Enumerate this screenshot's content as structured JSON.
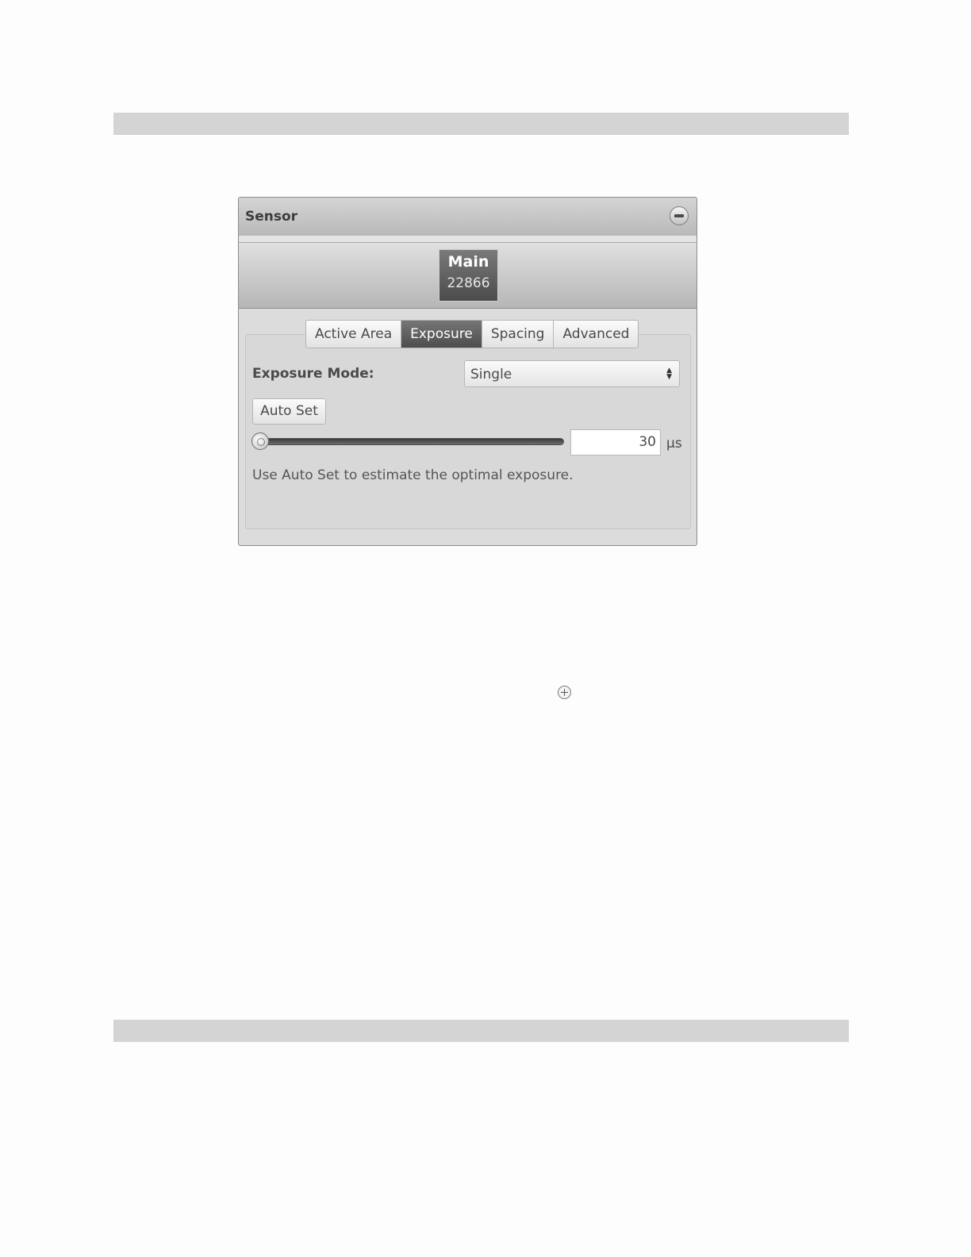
{
  "panel": {
    "title": "Sensor",
    "collapse_icon": "minus-circle-icon"
  },
  "sensor": {
    "name": "Main",
    "serial": "22866"
  },
  "tabs": [
    {
      "label": "Active Area",
      "active": false
    },
    {
      "label": "Exposure",
      "active": true
    },
    {
      "label": "Spacing",
      "active": false
    },
    {
      "label": "Advanced",
      "active": false
    }
  ],
  "exposure": {
    "mode_label": "Exposure Mode:",
    "mode_value": "Single",
    "auto_set_label": "Auto Set",
    "value": "30",
    "unit": "µs",
    "slider_fraction": 0.0,
    "hint": "Use Auto Set to estimate the optimal exposure."
  },
  "cursor_icon": "zoom-in-icon"
}
